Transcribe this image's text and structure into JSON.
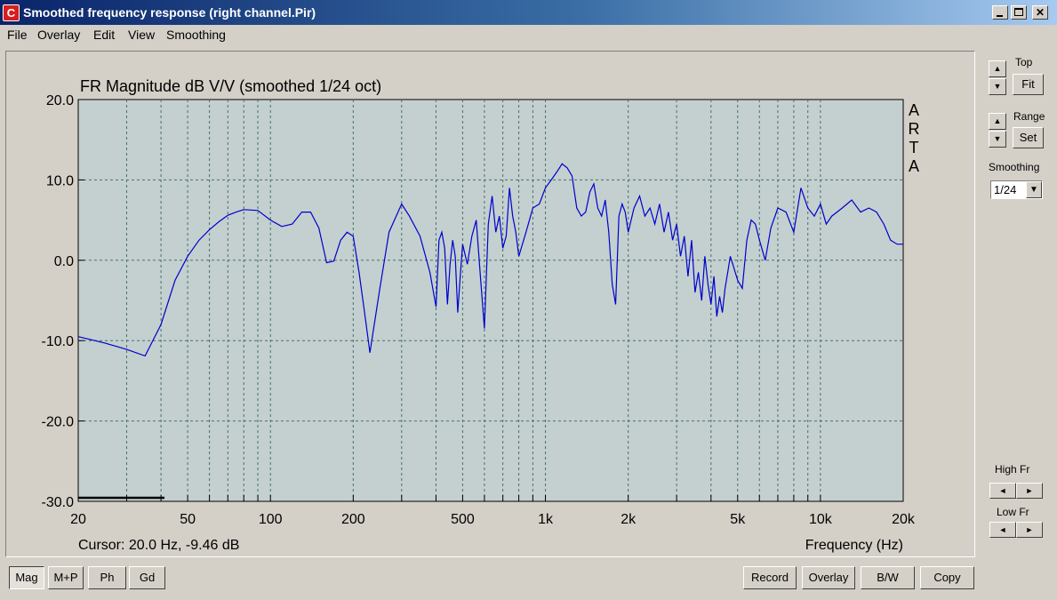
{
  "window": {
    "icon_letter": "C",
    "title": "Smoothed frequency response (right channel.Pir)",
    "min_glyph": "_",
    "max_glyph": "□",
    "close_glyph": "✕"
  },
  "menu": [
    "File",
    "Overlay",
    "Edit",
    "View",
    "Smoothing"
  ],
  "side": {
    "top_label": "Top",
    "fit_label": "Fit",
    "range_label": "Range",
    "set_label": "Set",
    "smoothing_label": "Smoothing",
    "smoothing_value": "1/24",
    "high_fr_label": "High Fr",
    "low_fr_label": "Low Fr",
    "up_glyph": "▲",
    "down_glyph": "▼",
    "left_glyph": "◄",
    "right_glyph": "►"
  },
  "view_buttons": [
    "Mag",
    "M+P",
    "Ph",
    "Gd"
  ],
  "action_buttons": [
    "Record",
    "Overlay",
    "B/W",
    "Copy"
  ],
  "colors": {
    "plot_bg": "#c3d0cf",
    "curve": "#0000cc",
    "grid": "#4a6e6e"
  },
  "chart_data": {
    "type": "line",
    "title": "FR Magnitude dB V/V (smoothed 1/24 oct)",
    "xlabel": "Frequency (Hz)",
    "ylabel": "",
    "x_scale": "log",
    "xlim": [
      20,
      20000
    ],
    "ylim": [
      -30,
      20
    ],
    "grid": true,
    "watermark": [
      "A",
      "R",
      "T",
      "A"
    ],
    "cursor_text": "Cursor: 20.0 Hz, -9.46 dB",
    "y_ticks": [
      20,
      10,
      0,
      -10,
      -20,
      -30
    ],
    "y_tick_labels": [
      "20.0",
      "10.0",
      "0.0",
      "-10.0",
      "-20.0",
      "-30.0"
    ],
    "x_tick_labels": [
      {
        "f": 20,
        "label": "20"
      },
      {
        "f": 50,
        "label": "50"
      },
      {
        "f": 100,
        "label": "100"
      },
      {
        "f": 200,
        "label": "200"
      },
      {
        "f": 500,
        "label": "500"
      },
      {
        "f": 1000,
        "label": "1k"
      },
      {
        "f": 2000,
        "label": "2k"
      },
      {
        "f": 5000,
        "label": "5k"
      },
      {
        "f": 10000,
        "label": "10k"
      },
      {
        "f": 20000,
        "label": "20k"
      }
    ],
    "series": [
      {
        "x": [
          20,
          25,
          30,
          35,
          40,
          45,
          50,
          55,
          60,
          65,
          70,
          75,
          80,
          90,
          100,
          110,
          120,
          130,
          140,
          150,
          160,
          170,
          180,
          190,
          200,
          210,
          220,
          230,
          250,
          270,
          300,
          320,
          350,
          380,
          400,
          410,
          420,
          430,
          440,
          450,
          460,
          470,
          480,
          490,
          500,
          520,
          540,
          560,
          580,
          600,
          620,
          640,
          660,
          680,
          700,
          720,
          740,
          760,
          780,
          800,
          850,
          900,
          950,
          1000,
          1050,
          1100,
          1150,
          1200,
          1250,
          1300,
          1350,
          1400,
          1450,
          1500,
          1550,
          1600,
          1650,
          1700,
          1750,
          1800,
          1850,
          1900,
          1950,
          2000,
          2100,
          2200,
          2300,
          2400,
          2500,
          2600,
          2700,
          2800,
          2900,
          3000,
          3100,
          3200,
          3300,
          3400,
          3500,
          3600,
          3700,
          3800,
          3900,
          4000,
          4100,
          4200,
          4300,
          4400,
          4500,
          4600,
          4700,
          4800,
          5000,
          5200,
          5400,
          5600,
          5800,
          6000,
          6300,
          6600,
          7000,
          7500,
          8000,
          8500,
          9000,
          9500,
          10000,
          10500,
          11000,
          12000,
          13000,
          14000,
          15000,
          16000,
          17000,
          18000,
          19000,
          20000
        ],
        "y": [
          -9.5,
          -10.3,
          -11.1,
          -11.9,
          -8.0,
          -2.5,
          0.5,
          2.5,
          3.8,
          4.8,
          5.6,
          6.0,
          6.3,
          6.2,
          5.0,
          4.2,
          4.5,
          6.0,
          6.0,
          4.0,
          -0.3,
          -0.1,
          2.5,
          3.5,
          3.0,
          -1.5,
          -6.5,
          -11.5,
          -3.5,
          3.5,
          7.0,
          5.5,
          3.0,
          -1.5,
          -5.8,
          2.5,
          3.5,
          1.5,
          -5.5,
          -0.5,
          2.5,
          0.5,
          -6.5,
          -2.0,
          2.0,
          -0.5,
          3.0,
          5.0,
          -2.0,
          -8.5,
          4.5,
          8.0,
          3.5,
          5.5,
          1.5,
          3.0,
          9.0,
          5.5,
          3.5,
          0.5,
          3.5,
          6.5,
          7.0,
          9.0,
          10.0,
          11.0,
          12.0,
          11.5,
          10.5,
          6.5,
          5.5,
          6.0,
          8.5,
          9.5,
          6.5,
          5.5,
          7.5,
          3.5,
          -3.0,
          -5.5,
          5.5,
          7.0,
          6.0,
          3.5,
          6.5,
          8.0,
          5.5,
          6.5,
          4.5,
          7.0,
          3.5,
          6.0,
          2.5,
          4.5,
          0.5,
          3.0,
          -2.0,
          2.5,
          -4.0,
          -1.5,
          -5.0,
          0.5,
          -3.0,
          -5.5,
          -2.0,
          -7.0,
          -4.5,
          -6.5,
          -3.5,
          -1.5,
          0.5,
          -0.5,
          -2.5,
          -3.5,
          2.5,
          5.0,
          4.5,
          2.5,
          0.0,
          4.0,
          6.5,
          6.0,
          3.5,
          9.0,
          6.5,
          5.5,
          7.0,
          4.5,
          5.5,
          6.5,
          7.5,
          6.0,
          6.5,
          6.0,
          4.5,
          2.5,
          2.0,
          2.0
        ]
      }
    ]
  }
}
